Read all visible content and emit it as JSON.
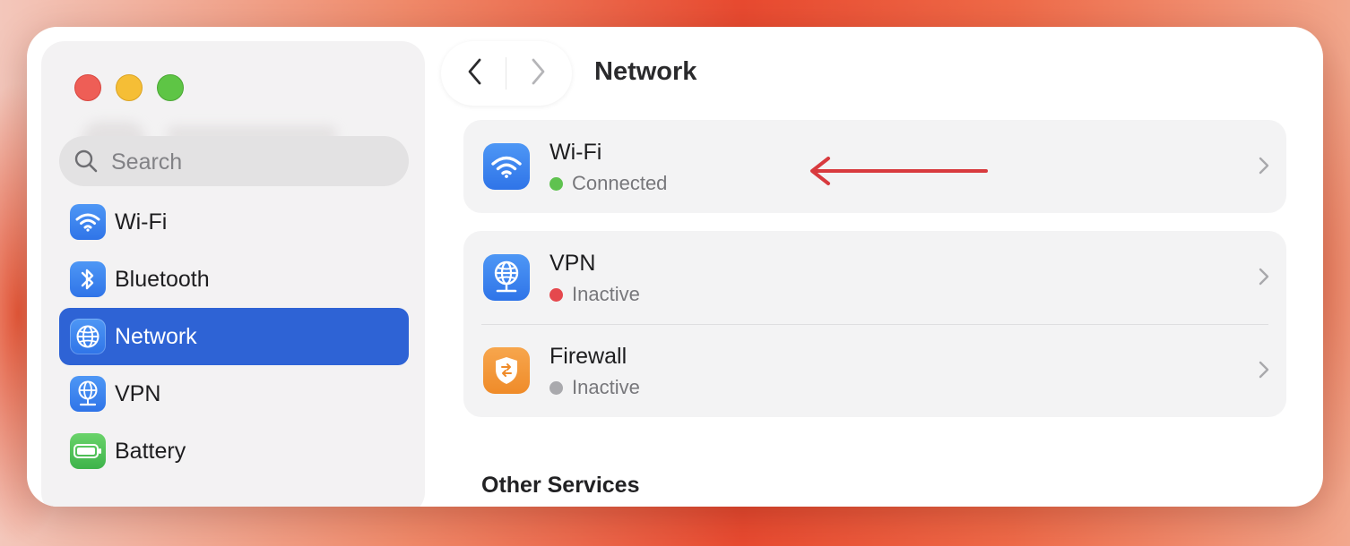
{
  "window": {
    "traffic_lights": [
      "close",
      "minimize",
      "zoom"
    ]
  },
  "sidebar": {
    "search": {
      "placeholder": "Search",
      "value": ""
    },
    "items": [
      {
        "label": "Wi-Fi",
        "icon": "wifi-icon",
        "active": false
      },
      {
        "label": "Bluetooth",
        "icon": "bluetooth-icon",
        "active": false
      },
      {
        "label": "Network",
        "icon": "globe-icon",
        "active": true
      },
      {
        "label": "VPN",
        "icon": "vpn-globe-icon",
        "active": false
      },
      {
        "label": "Battery",
        "icon": "battery-icon",
        "active": false
      }
    ]
  },
  "header": {
    "title": "Network",
    "back_icon": "chevron-left-icon",
    "forward_icon": "chevron-right-icon"
  },
  "main": {
    "services": [
      {
        "name": "Wi-Fi",
        "status": "Connected",
        "status_color": "#5fc24f",
        "icon": "wifi-icon"
      },
      {
        "name": "VPN",
        "status": "Inactive",
        "status_color": "#e5484d",
        "icon": "vpn-globe-icon"
      },
      {
        "name": "Firewall",
        "status": "Inactive",
        "status_color": "#a9a9ad",
        "icon": "firewall-shield-icon"
      }
    ],
    "other_services_title": "Other Services"
  },
  "colors": {
    "accent": "#2e63d5",
    "annotation_arrow": "#d83a3e"
  }
}
